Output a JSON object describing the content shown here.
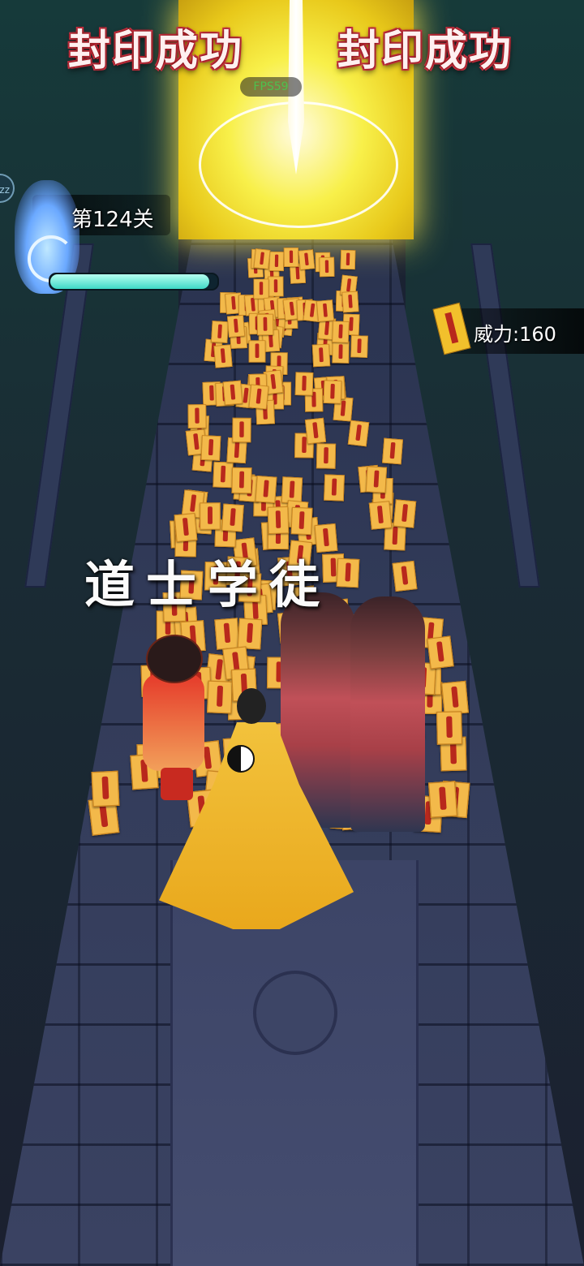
{
  "hud": {
    "fps": "FPS59",
    "level": "第124关",
    "power": "威力:160",
    "hp_fraction": 0.95,
    "side_bubble": "zz"
  },
  "banners": {
    "left": "封印成功",
    "right": "封印成功"
  },
  "skill_popup": "道士学徒",
  "icons": {
    "level": "blue-spirit-flame-icon",
    "power": "talisman-icon"
  },
  "colors": {
    "hp_bar": "#3ed8c6",
    "banner_text": "#fff0f0",
    "banner_outline": "#d2364a",
    "talisman": "#f3b94a",
    "gate_glow": "#f8f04a"
  }
}
